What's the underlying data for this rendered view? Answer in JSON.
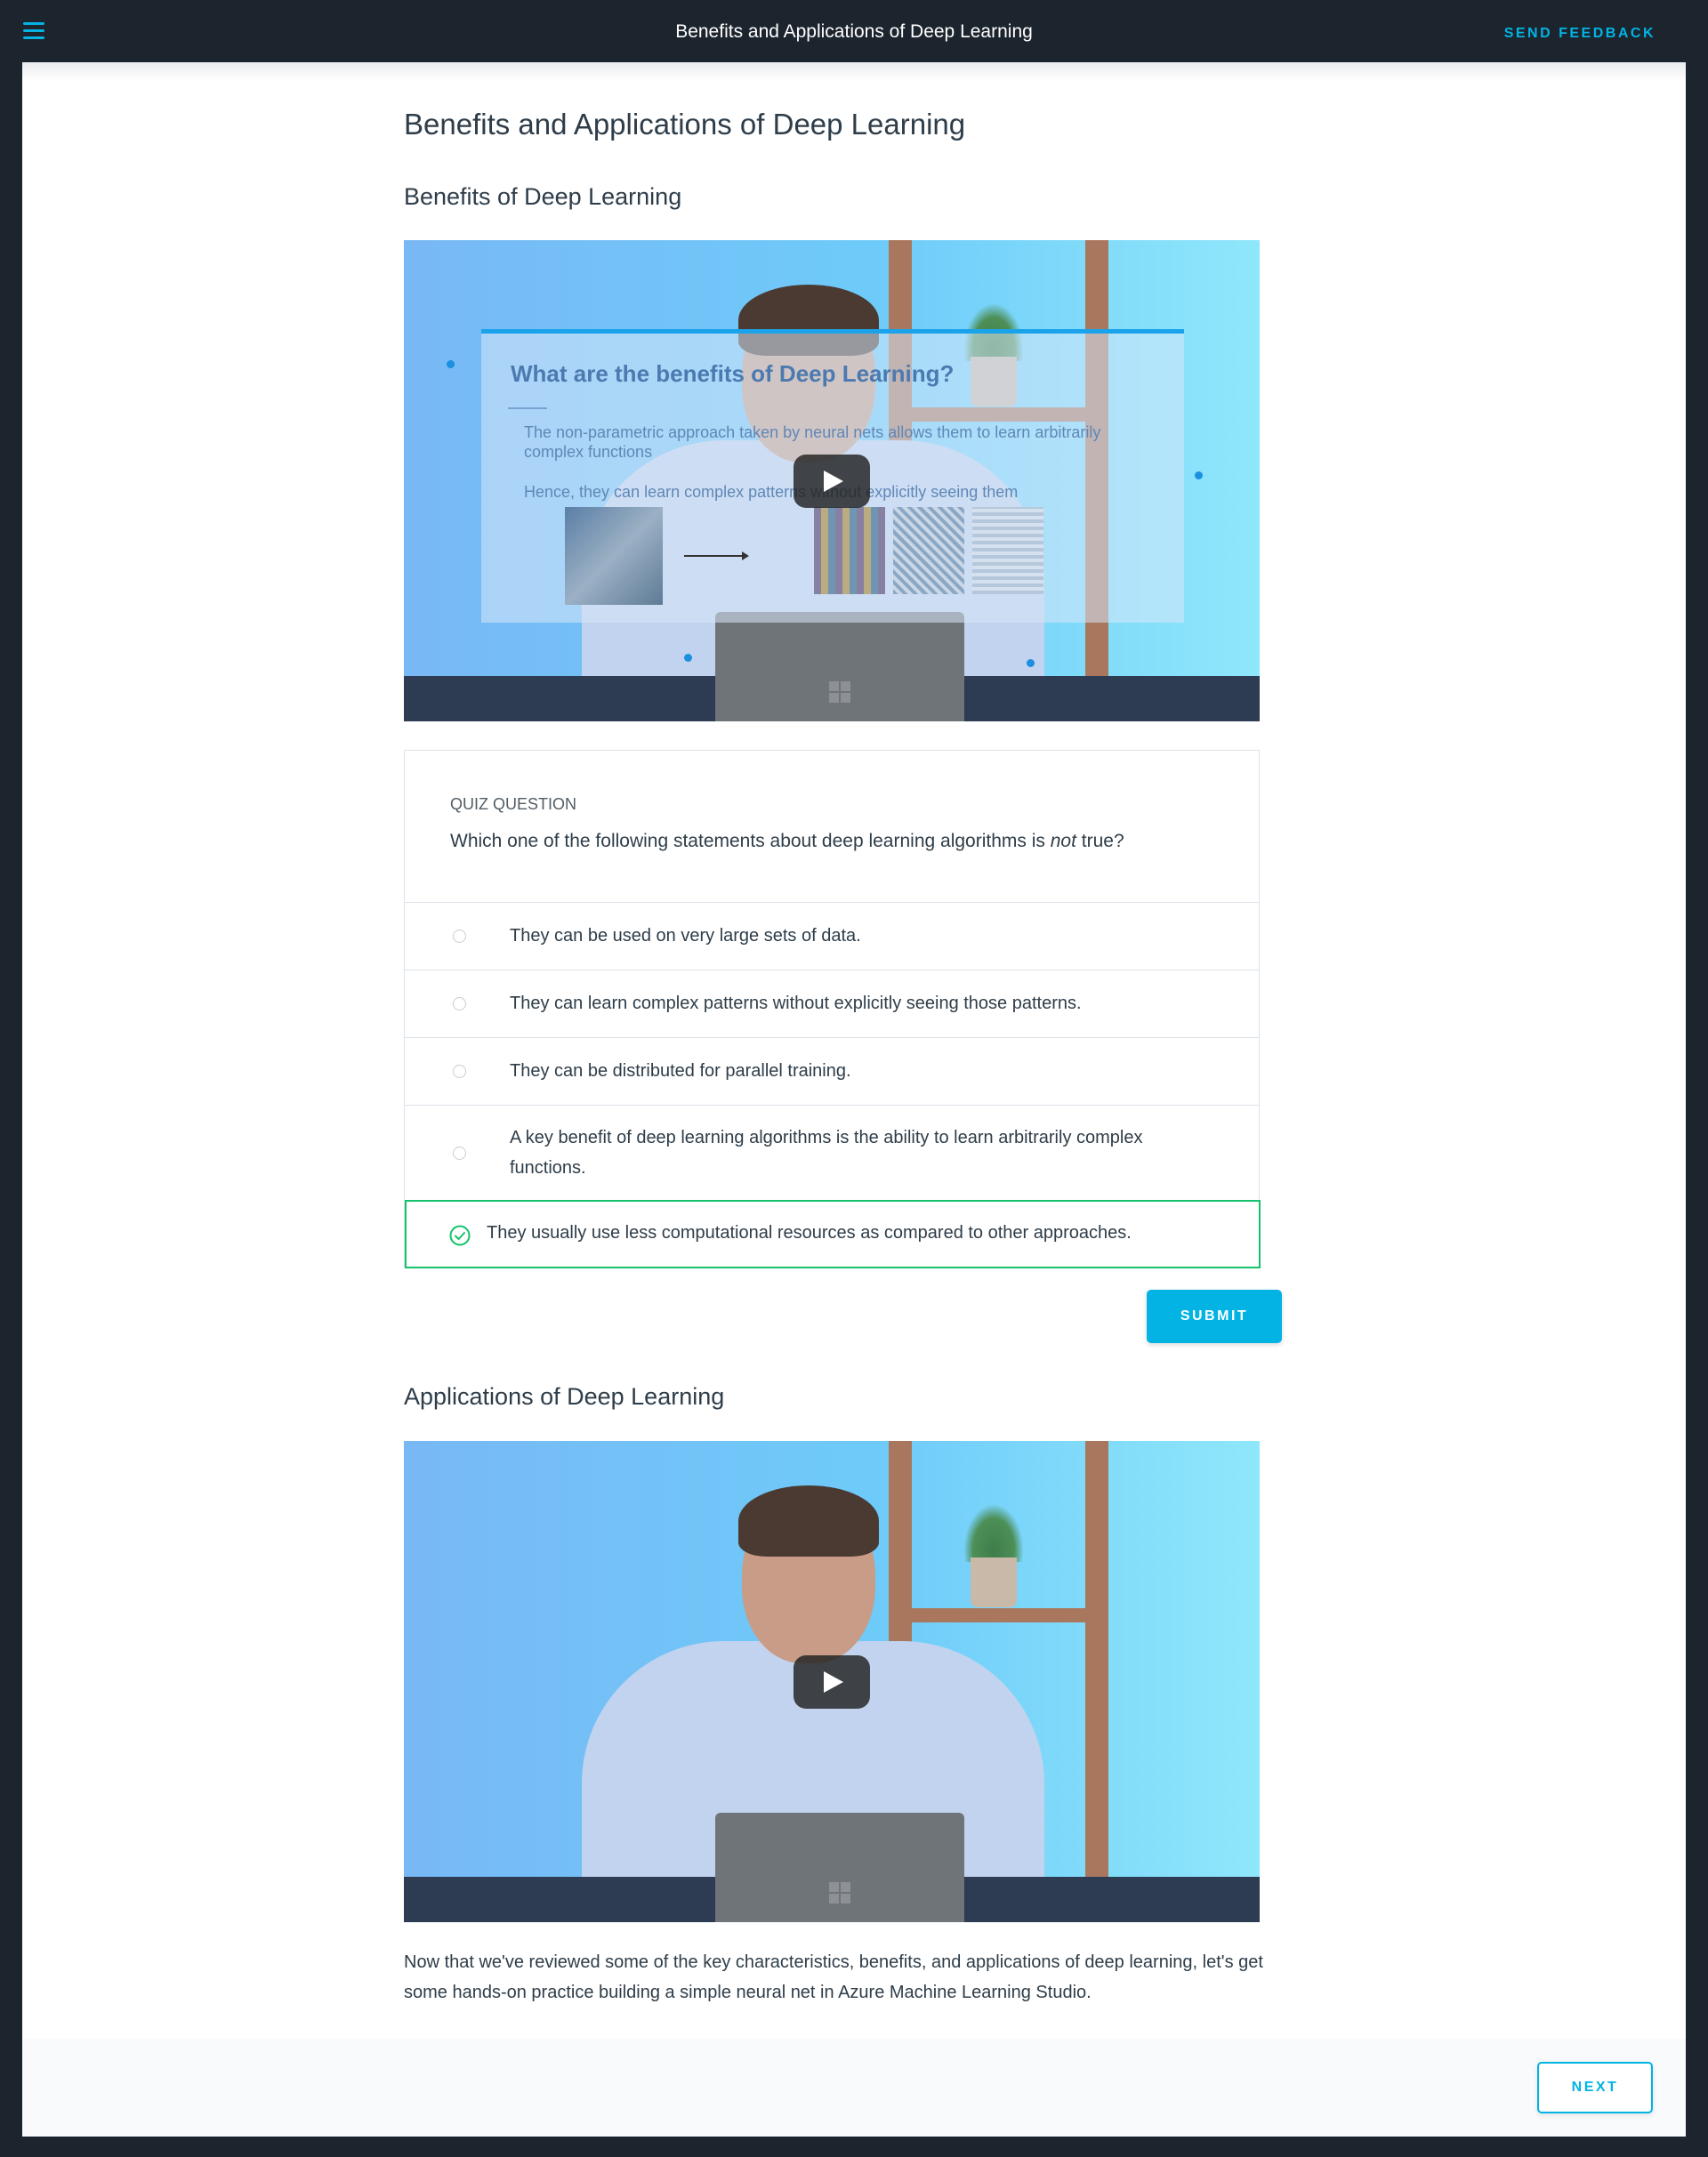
{
  "header": {
    "title": "Benefits and Applications of Deep Learning",
    "feedback_label": "SEND FEEDBACK"
  },
  "main": {
    "title": "Benefits and Applications of Deep Learning",
    "section1_heading": "Benefits of Deep Learning",
    "video1": {
      "slide_title": "What are the benefits of Deep Learning?",
      "slide_text1": "The non-parametric approach taken by neural nets allows them to learn arbitrarily complex functions",
      "slide_text2": "Hence, they can learn complex patterns without explicitly seeing them"
    },
    "quiz": {
      "label": "QUIZ QUESTION",
      "question_before": "Which one of the following statements about deep learning algorithms is ",
      "question_em": "not",
      "question_after": " true?",
      "options": [
        "They can be used on very large sets of data.",
        "They can learn complex patterns without explicitly seeing those patterns.",
        "They can be distributed for parallel training.",
        "A key benefit of deep learning algorithms is the ability to learn arbitrarily complex functions."
      ],
      "selected_option": "They usually use less computational resources as compared to other approaches.",
      "submit_label": "SUBMIT"
    },
    "section2_heading": "Applications of Deep Learning",
    "outro_text": "Now that we've reviewed some of the key characteristics, benefits, and applications of deep learning, let's get some hands-on practice building a simple neural net in Azure Machine Learning Studio."
  },
  "footer": {
    "next_label": "NEXT"
  },
  "colors": {
    "accent": "#02b3e4",
    "correct": "#15c26b",
    "dark": "#1c252e"
  }
}
